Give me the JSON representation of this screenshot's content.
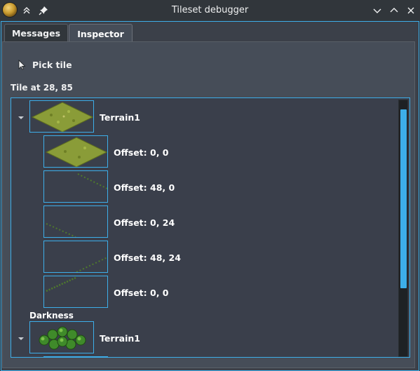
{
  "window": {
    "title": "Tileset debugger"
  },
  "tabs": [
    {
      "label": "Messages",
      "active": false
    },
    {
      "label": "Inspector",
      "active": true
    }
  ],
  "inspector": {
    "pick_tile_label": "Pick tile",
    "tile_heading": "Tile at 28, 85",
    "tree": {
      "group1_label": "Terrain1",
      "offsets": [
        "Offset: 0, 0",
        "Offset: 48, 0",
        "Offset: 0, 24",
        "Offset: 48, 24",
        "Offset: 0, 0"
      ],
      "section_label": "Darkness",
      "group2_label": "Terrain1"
    }
  },
  "colors": {
    "accent": "#3daee9",
    "background": "#31363b",
    "panel": "#464d58"
  }
}
